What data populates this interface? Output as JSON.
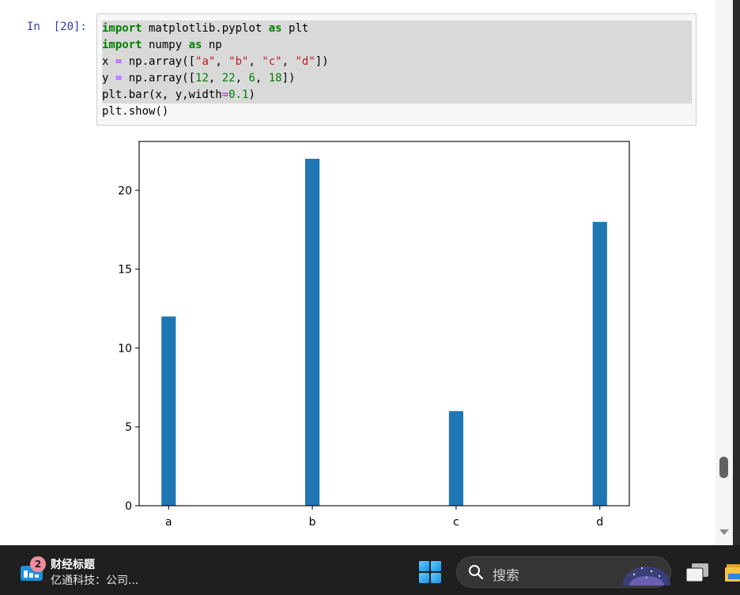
{
  "cell": {
    "prompt": "In  [20]:",
    "code_lines": [
      [
        {
          "t": "import",
          "c": "kw"
        },
        {
          "t": " matplotlib.pyplot ",
          "c": ""
        },
        {
          "t": "as",
          "c": "kw"
        },
        {
          "t": " plt",
          "c": ""
        }
      ],
      [
        {
          "t": "import",
          "c": "kw"
        },
        {
          "t": " numpy ",
          "c": ""
        },
        {
          "t": "as",
          "c": "kw"
        },
        {
          "t": " np",
          "c": ""
        }
      ],
      [
        {
          "t": "x ",
          "c": ""
        },
        {
          "t": "=",
          "c": "op"
        },
        {
          "t": " np.array([",
          "c": ""
        },
        {
          "t": "\"a\"",
          "c": "str"
        },
        {
          "t": ", ",
          "c": ""
        },
        {
          "t": "\"b\"",
          "c": "str"
        },
        {
          "t": ", ",
          "c": ""
        },
        {
          "t": "\"c\"",
          "c": "str"
        },
        {
          "t": ", ",
          "c": ""
        },
        {
          "t": "\"d\"",
          "c": "str"
        },
        {
          "t": "])",
          "c": ""
        }
      ],
      [
        {
          "t": "y ",
          "c": ""
        },
        {
          "t": "=",
          "c": "op"
        },
        {
          "t": " np.array([",
          "c": ""
        },
        {
          "t": "12",
          "c": "num"
        },
        {
          "t": ", ",
          "c": ""
        },
        {
          "t": "22",
          "c": "num"
        },
        {
          "t": ", ",
          "c": ""
        },
        {
          "t": "6",
          "c": "num"
        },
        {
          "t": ", ",
          "c": ""
        },
        {
          "t": "18",
          "c": "num"
        },
        {
          "t": "])",
          "c": ""
        }
      ],
      [
        {
          "t": "plt.bar(x, y,width",
          "c": ""
        },
        {
          "t": "=",
          "c": "op"
        },
        {
          "t": "0.1",
          "c": "num"
        },
        {
          "t": ")",
          "c": ""
        }
      ],
      [
        {
          "t": "plt.show()",
          "c": ""
        }
      ]
    ]
  },
  "chart_data": {
    "type": "bar",
    "categories": [
      "a",
      "b",
      "c",
      "d"
    ],
    "values": [
      12,
      22,
      6,
      18
    ],
    "bar_width": 0.1,
    "bar_color": "#1f77b4",
    "ylim": [
      0,
      23.1
    ],
    "yticks": [
      0,
      5,
      10,
      15,
      20
    ],
    "title": "",
    "xlabel": "",
    "ylabel": "",
    "grid": false
  },
  "taskbar": {
    "news_badge": "2",
    "news_title": "财经标题",
    "news_subtitle": "亿通科技：公司...",
    "search_placeholder": "搜索",
    "icons": [
      "news-widget-icon",
      "windows-start-icon",
      "search-icon",
      "task-view-icon",
      "file-explorer-icon"
    ]
  }
}
